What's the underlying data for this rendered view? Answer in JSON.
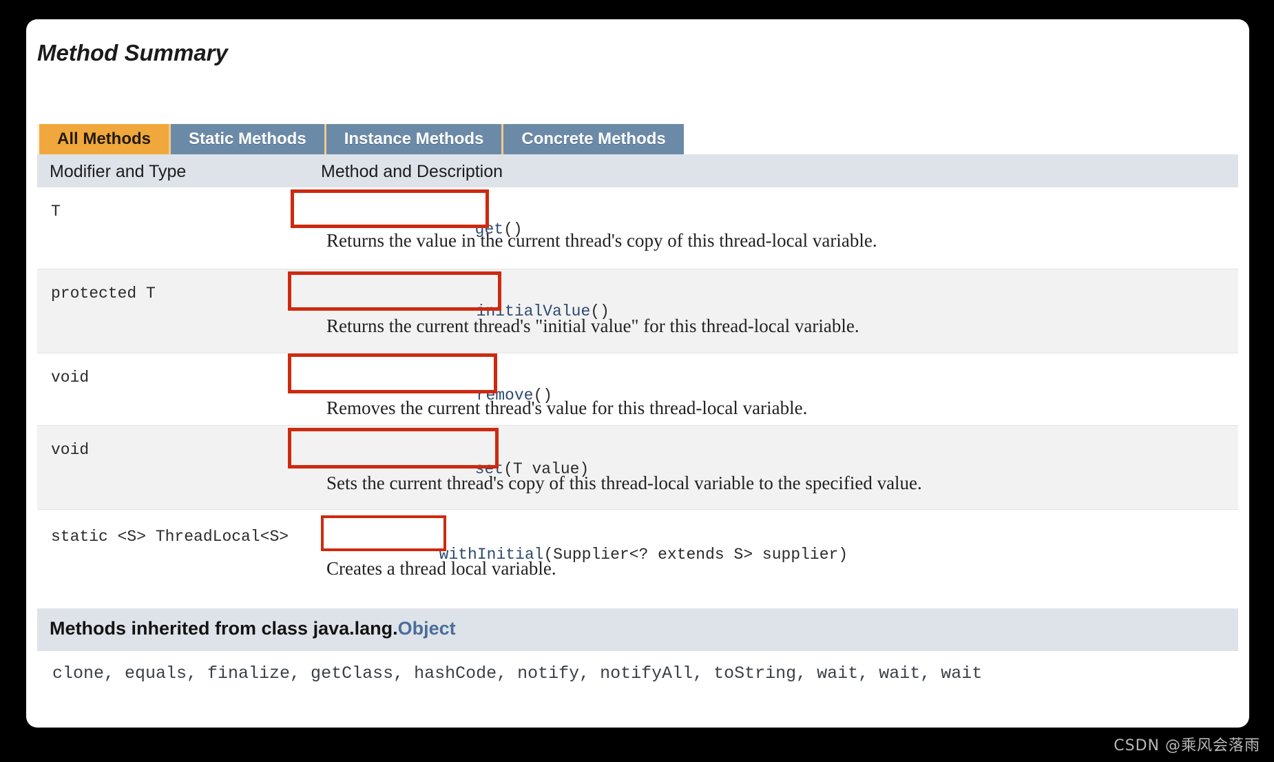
{
  "section": {
    "title": "Method Summary"
  },
  "tabs": [
    {
      "label": "All Methods",
      "active": true
    },
    {
      "label": "Static Methods",
      "active": false
    },
    {
      "label": "Instance Methods",
      "active": false
    },
    {
      "label": "Concrete Methods",
      "active": false
    }
  ],
  "table": {
    "headers": {
      "col1": "Modifier and Type",
      "col2": "Method and Description"
    },
    "rows": [
      {
        "modifier_and_type": "T",
        "signature_prefix": "",
        "method_name": "get",
        "signature_suffix": "()",
        "description": "Returns the value in the current thread's copy of this thread-local variable."
      },
      {
        "modifier_and_type": "protected T",
        "signature_prefix": "",
        "method_name": "initialValue",
        "signature_suffix": "()",
        "description": "Returns the current thread's \"initial value\" for this thread-local variable."
      },
      {
        "modifier_and_type": "void",
        "signature_prefix": "",
        "method_name": "remove",
        "signature_suffix": "()",
        "description": "Removes the current thread's value for this thread-local variable."
      },
      {
        "modifier_and_type": "void",
        "signature_prefix": "",
        "method_name": "set",
        "signature_suffix": "(T value)",
        "description": "Sets the current thread's copy of this thread-local variable to the specified value."
      },
      {
        "modifier_and_type": "static <S> ThreadLocal<S>",
        "signature_prefix": "",
        "method_name": "withInitial",
        "signature_suffix": "(Supplier<? extends S> supplier)",
        "description": "Creates a thread local variable."
      }
    ]
  },
  "inherited": {
    "heading_prefix": "Methods inherited from class java.lang.",
    "heading_link": "Object",
    "methods": "clone, equals, finalize, getClass, hashCode, notify, notifyAll, toString, wait, wait, wait"
  },
  "watermark": {
    "text": "CSDN @乘风会落雨"
  },
  "colors": {
    "tab_active_bg": "#f0a83c",
    "tab_inactive_bg": "#6b8aa8",
    "header_bg": "#dee3e9",
    "annotation_red": "#cd2a0f",
    "link_blue": "#4a6e99"
  }
}
